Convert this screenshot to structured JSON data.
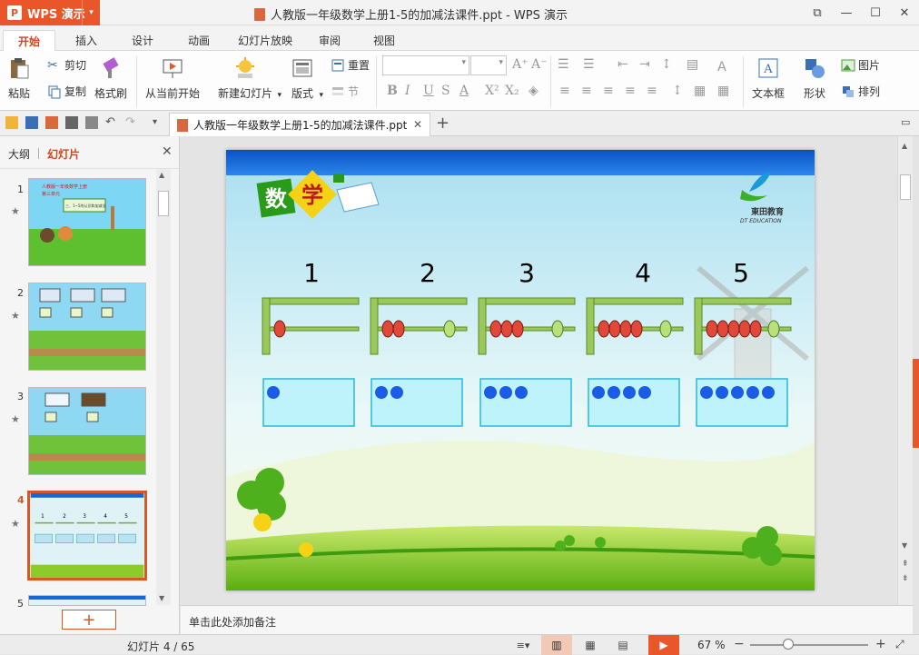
{
  "app": {
    "name": "WPS 演示",
    "logo_glyph": "P",
    "dropdown": "▾"
  },
  "window": {
    "title": "人教版一年级数学上册1-5的加减法课件.ppt - WPS 演示"
  },
  "ribbon_tabs": [
    "开始",
    "插入",
    "设计",
    "动画",
    "幻灯片放映",
    "审阅",
    "视图"
  ],
  "ribbon": {
    "paste": "粘贴",
    "cut": "剪切",
    "copy": "复制",
    "format_painter": "格式刷",
    "from_current": "从当前开始",
    "new_slide": "新建幻灯片",
    "layout": "版式",
    "reset": "重置",
    "section": "节",
    "textbox": "文本框",
    "shape": "形状",
    "picture": "图片",
    "arrange": "排列",
    "font_name": "",
    "font_size": ""
  },
  "doc_tab": {
    "label": "人教版一年级数学上册1-5的加减法课件.ppt",
    "close": "✕",
    "new": "+"
  },
  "panel": {
    "tab_outline": "大纲",
    "tab_slides": "幻灯片",
    "close": "✕",
    "add_button": "+",
    "slides": [
      {
        "num": "1"
      },
      {
        "num": "2"
      },
      {
        "num": "3"
      },
      {
        "num": "4"
      },
      {
        "num": "5"
      }
    ],
    "thumb1_title": "人教版一年级数学上册",
    "thumb1_sub": "第三单元",
    "thumb1_box": "三、1~5的认识和加减法"
  },
  "slide": {
    "header_badge": [
      "数",
      "学"
    ],
    "logo_name": "東田教育",
    "logo_sub": "DT EDUCATION",
    "numbers": [
      "1",
      "2",
      "3",
      "4",
      "5"
    ],
    "dot_counts": [
      1,
      2,
      3,
      4,
      5
    ],
    "bead_counts": [
      1,
      2,
      3,
      4,
      5
    ]
  },
  "notes": {
    "placeholder": "单击此处添加备注"
  },
  "status": {
    "slide_info": "幻灯片 4 / 65",
    "zoom": "67 %"
  },
  "colors": {
    "accent": "#e8562a",
    "active_tab": "#d0451b",
    "slide_blue": "#1568d8",
    "dot_blue": "#1a5ce6"
  }
}
